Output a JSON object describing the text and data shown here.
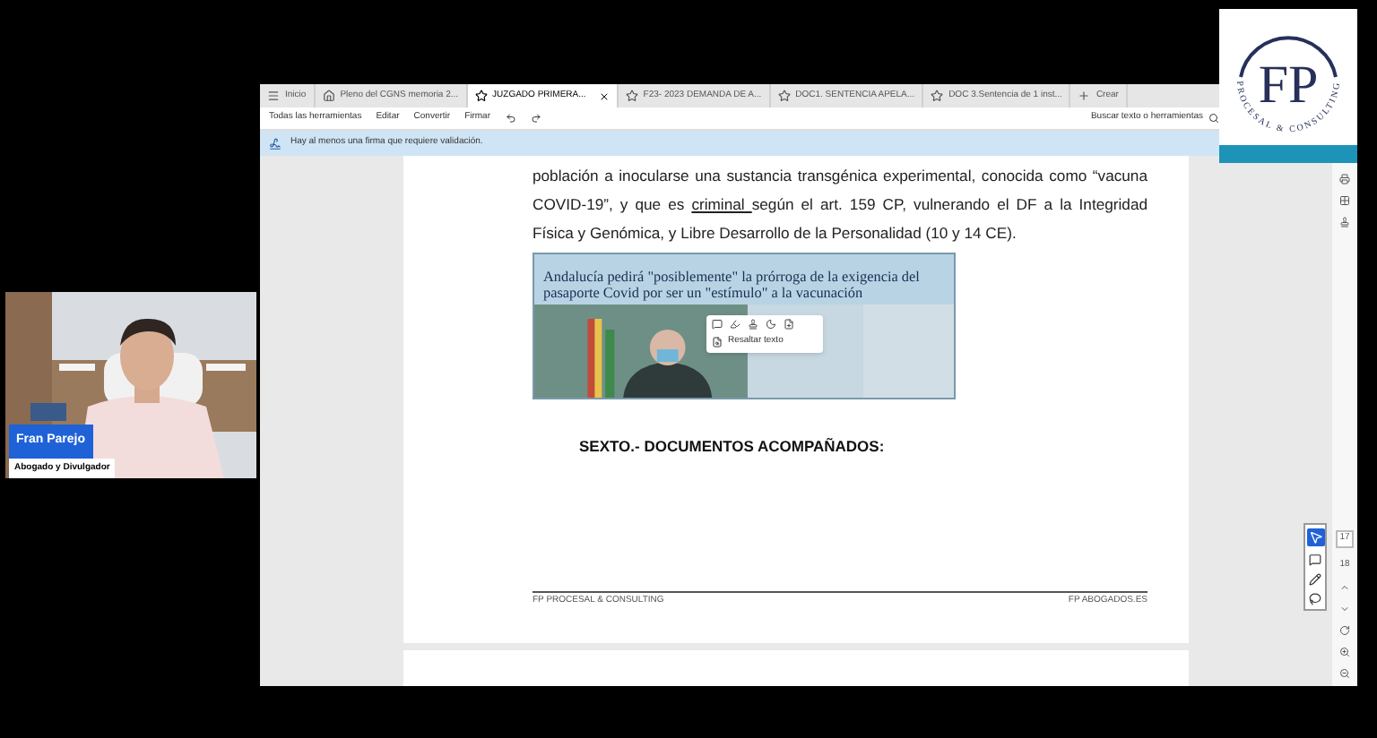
{
  "webcam": {
    "name": "Fran Parejo",
    "role": "Abogado y Divulgador"
  },
  "logo": {
    "initials": "FP",
    "tagline": "PROCESAL & CONSULTING"
  },
  "tabs": [
    {
      "label": "Inicio",
      "kind": "menu",
      "selected": false
    },
    {
      "label": "Pleno del CGNS memoria 2...",
      "kind": "home",
      "selected": false
    },
    {
      "label": "JUZGADO PRIMERA...",
      "kind": "doc",
      "selected": true
    },
    {
      "label": "F23- 2023 DEMANDA DE A...",
      "kind": "doc",
      "selected": false
    },
    {
      "label": "DOC1. SENTENCIA APELA...",
      "kind": "doc",
      "selected": false
    },
    {
      "label": "DOC 3.Sentencia de 1 inst...",
      "kind": "doc",
      "selected": false
    },
    {
      "label": "Crear",
      "kind": "new",
      "selected": false
    }
  ],
  "toolbar": {
    "items": [
      "Todas las herramientas",
      "Editar",
      "Convertir",
      "Firmar"
    ],
    "search": "Buscar texto o herramientas"
  },
  "banner": "Hay al menos una firma que requiere validación.",
  "document": {
    "paragraph": [
      {
        "text": "población a inocularse una sustancia transgénica experimental, conocida como “vacuna COVID-19”, y que es ",
        "underline": false
      },
      {
        "text": "criminal ",
        "underline": true
      },
      {
        "text": "según el art. 159 CP, vulnerando el DF a la Integridad Física y Genómica, y Libre Desarrollo de la Personalidad (10 y 14 CE).",
        "underline": false
      }
    ],
    "clipping": {
      "headline": "Andalucía pedirá \"posiblemente\" la prórroga de la exigencia del pasaporte Covid por ser un \"estímulo\" a la vacunación",
      "menu_item": "Resaltar texto"
    },
    "heading": "SEXTO.- DOCUMENTOS ACOMPAÑADOS:",
    "footer_left": "FP PROCESAL & CONSULTING",
    "footer_right": "FP ABOGADOS.ES"
  },
  "page_controls": {
    "current": "17",
    "total": "18"
  }
}
